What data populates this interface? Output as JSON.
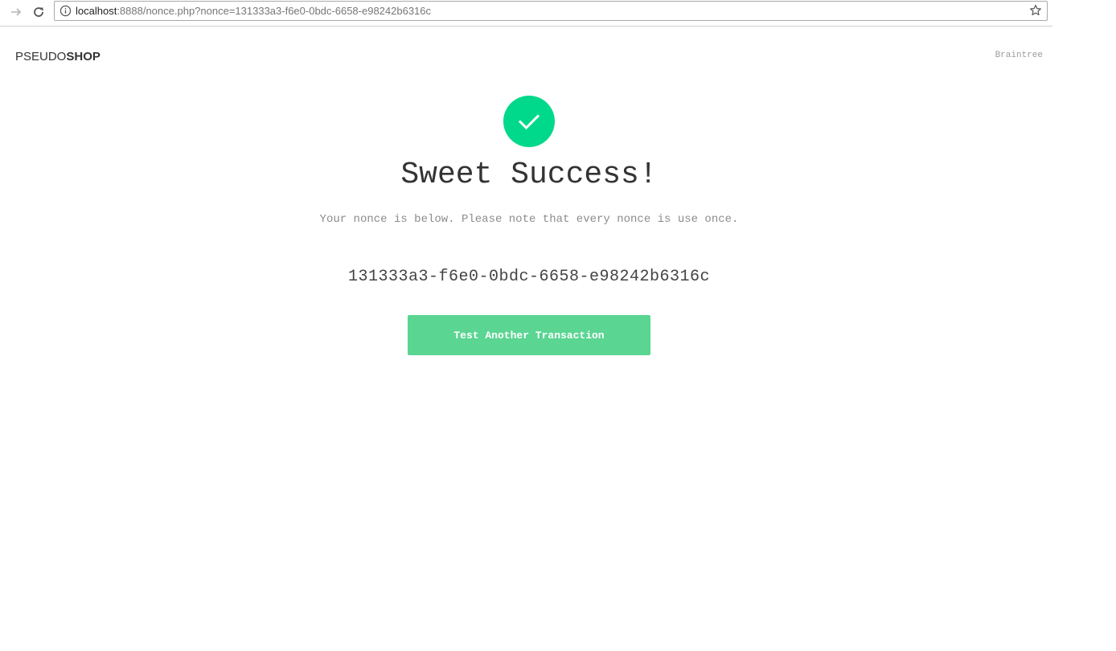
{
  "browser": {
    "url_host": "localhost",
    "url_rest": ":8888/nonce.php?nonce=131333a3-f6e0-0bdc-6658-e98242b6316c",
    "icons": [
      "forward-arrow-icon",
      "reload-icon",
      "info-icon",
      "star-icon"
    ]
  },
  "header": {
    "brand_light": "PSEUDO",
    "brand_bold": "SHOP",
    "right_link": "Braintree"
  },
  "main": {
    "title": "Sweet Success!",
    "subtitle": "Your nonce is below. Please note that every nonce is use once.",
    "nonce": "131333a3-f6e0-0bdc-6658-e98242b6316c",
    "cta_label": "Test Another Transaction"
  },
  "colors": {
    "success_green": "#00d98b",
    "button_green": "#5ad592",
    "text_dark": "#333333",
    "text_muted": "#8c8c8c"
  }
}
